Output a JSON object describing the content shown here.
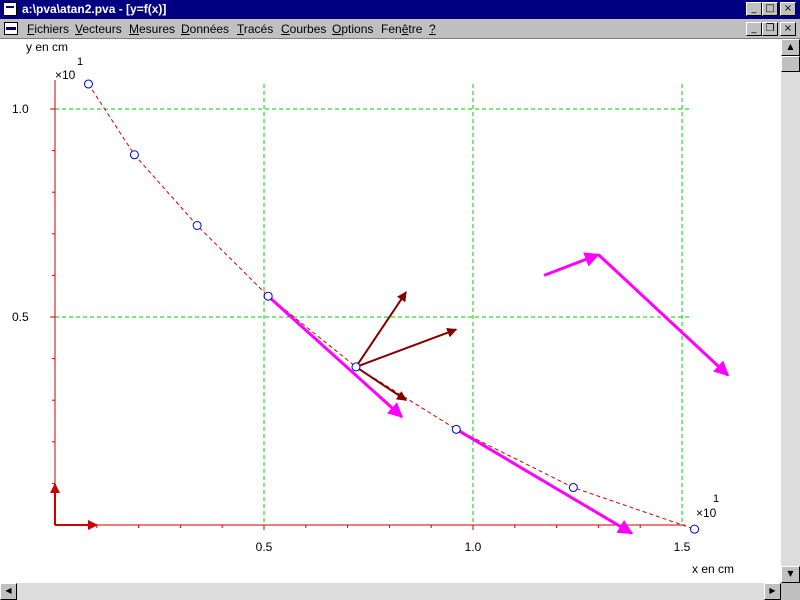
{
  "window": {
    "title": "a:\\pva\\atan2.pva - [y=f(x)]",
    "controls": {
      "minimize": "_",
      "maximize": "□",
      "close": "×",
      "restore": "❐"
    }
  },
  "menu": [
    {
      "label": "Fichiers",
      "ul": "F",
      "rest": "ichiers"
    },
    {
      "label": "Vecteurs",
      "ul": "V",
      "rest": "ecteurs"
    },
    {
      "label": "Mesures",
      "ul": "M",
      "rest": "esures"
    },
    {
      "label": "Données",
      "ul": "D",
      "rest": "onnées"
    },
    {
      "label": "Tracés",
      "ul": "T",
      "rest": "racés"
    },
    {
      "label": "Courbes",
      "ul": "C",
      "rest": "ourbes"
    },
    {
      "label": "Options",
      "ul": "O",
      "rest": "ptions"
    },
    {
      "label": "Fenêtre",
      "pre": "Fen",
      "ul": "ê",
      "rest": "tre"
    },
    {
      "label": "?",
      "ul": "?",
      "rest": ""
    }
  ],
  "plot": {
    "y_axis_label": "y en cm",
    "x_axis_label": "x en cm",
    "y_multiplier": "×10",
    "y_multiplier_exp": "1",
    "x_multiplier": "×10",
    "x_multiplier_exp": "1",
    "y_ticks": [
      "1.0",
      "0.5"
    ],
    "x_ticks": [
      "0.5",
      "1.0",
      "1.5"
    ],
    "colors": {
      "grid": "#00cc00",
      "axis": "#cc0000",
      "curve": "#cc0000",
      "points": "#0000cc",
      "velocity": "#ff00ff",
      "accel": "#800000"
    }
  },
  "chart_data": {
    "type": "scatter",
    "xlabel": "x en cm",
    "ylabel": "y en cm",
    "xlim": [
      0,
      1.55
    ],
    "ylim": [
      0,
      1.05
    ],
    "grid": true,
    "series": [
      {
        "x": [
          0.08,
          0.19,
          0.34,
          0.51,
          0.72,
          0.96,
          1.24,
          1.53
        ],
        "y": [
          1.06,
          0.89,
          0.72,
          0.55,
          0.38,
          0.23,
          0.09,
          -0.01
        ]
      }
    ],
    "velocity_vectors": [
      {
        "from": [
          0.51,
          0.55
        ],
        "to": [
          0.83,
          0.26
        ]
      },
      {
        "from": [
          0.96,
          0.23
        ],
        "to": [
          1.38,
          -0.02
        ]
      },
      {
        "from": [
          1.17,
          0.6
        ],
        "to": [
          1.3,
          0.65
        ]
      },
      {
        "from": [
          1.3,
          0.65
        ],
        "to": [
          1.61,
          0.36
        ]
      }
    ],
    "accel_vectors": [
      {
        "from": [
          0.72,
          0.38
        ],
        "to": [
          0.84,
          0.56
        ]
      },
      {
        "from": [
          0.72,
          0.38
        ],
        "to": [
          0.96,
          0.47
        ]
      },
      {
        "from": [
          0.72,
          0.38
        ],
        "to": [
          0.84,
          0.3
        ]
      }
    ]
  }
}
